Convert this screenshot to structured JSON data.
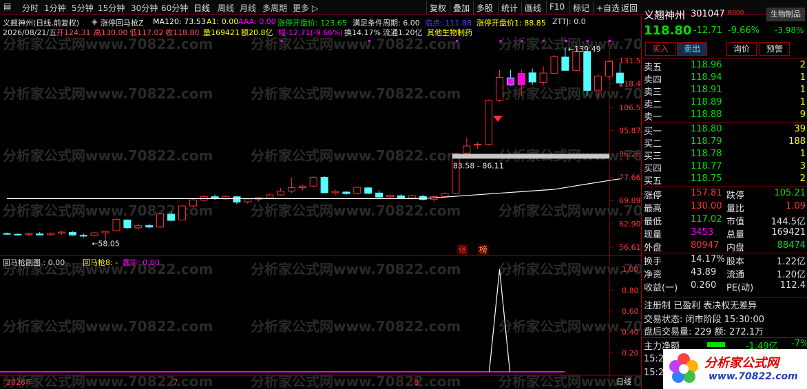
{
  "toolbar": {
    "left": [
      "分时",
      "1分钟",
      "5分钟",
      "15分钟",
      "30分钟",
      "60分钟",
      "日线",
      "周线",
      "月线",
      "多周期",
      "更多 ▷"
    ],
    "right": [
      "复权",
      "叠加",
      "多股",
      "统计",
      "画线",
      "F10",
      "标记",
      "+自选",
      "返回"
    ]
  },
  "header": {
    "title": "义翘神州(日线,前复权)",
    "indicator": "涨停回马枪Z",
    "ma120": "MA120: 73.53",
    "a1": "A1: 0.00",
    "aaa": "AAA: 0.00",
    "open_price_line": "涨停开盘价: 123.65",
    "cond": "满足条件周期: 6.00",
    "sell_point": "临点: 111.88",
    "zt_open": "涨停开盘价1: 88.85",
    "zttj": "ZTTJ: 0.0"
  },
  "header2": {
    "date": "2026/08/21/五",
    "open": "开124.31",
    "high": "高130.00",
    "low": "低117.02",
    "close": "收118.80",
    "vol": "量169421",
    "amount": "额20.8亿",
    "change": "幅-12.71(-9.66%)",
    "turnover": "换14.17%",
    "float": "流通1.20亿",
    "industry": "其他生物制药"
  },
  "chart": {
    "yticks": [
      "131.5",
      "118.4",
      "106.5",
      "95.87",
      "86.28",
      "77.66",
      "69.89",
      "62.90",
      "56.61"
    ],
    "max_label": "139.49",
    "min_label": "58.05",
    "zone_label": "83.58 - 86.11",
    "tags": [
      "张",
      "榜"
    ],
    "xlabels": [
      "2026年",
      "7",
      "8"
    ],
    "period": "日线"
  },
  "sub": {
    "title": "回马枪副图 : 0.00",
    "s1": "回马枪8: -",
    "s2": "蠢牛: 0.00",
    "yticks": [
      "1.00",
      "0.80",
      "0.60",
      "0.40",
      "0.20"
    ]
  },
  "watermark": "分析家公式网www.70822.com",
  "stock": {
    "name": "义翘神州",
    "code": "301047",
    "tag": "R000",
    "sector": "生物制品",
    "price": "118.80",
    "chg": "-12.71",
    "pct": "-9.66%",
    "sector_pct": "-3.98%"
  },
  "buttons": [
    "买入",
    "卖出",
    "询价",
    "预警"
  ],
  "asks": [
    [
      "卖五",
      "118.96",
      "2"
    ],
    [
      "卖四",
      "118.94",
      "1"
    ],
    [
      "卖三",
      "118.91",
      "1"
    ],
    [
      "卖二",
      "118.89",
      "1"
    ],
    [
      "卖一",
      "118.88",
      "9"
    ]
  ],
  "bids": [
    [
      "买一",
      "118.80",
      "39"
    ],
    [
      "买二",
      "118.79",
      "188"
    ],
    [
      "买三",
      "118.78",
      "1"
    ],
    [
      "买四",
      "118.77",
      "3"
    ],
    [
      "买五",
      "118.75",
      "2"
    ]
  ],
  "stats": [
    [
      "涨停",
      "157.81",
      "跌停",
      "105.21"
    ],
    [
      "最高",
      "130.00",
      "量比",
      "1.09"
    ],
    [
      "最低",
      "117.02",
      "市值",
      "144.5亿"
    ],
    [
      "现量",
      "3453",
      "总量",
      "169421"
    ],
    [
      "外盘",
      "80947",
      "内盘",
      "88474"
    ]
  ],
  "stats2": [
    [
      "换手",
      "14.17%",
      "股本",
      "1.22亿"
    ],
    [
      "净资",
      "43.89",
      "流通",
      "1.20亿"
    ],
    [
      "收益(一)",
      "0.260",
      "PE(动)",
      "112.4"
    ]
  ],
  "notes": {
    "reg": "注册制 已盈利 表决权无差异",
    "state": "交易状态: 闭市阶段 15:30:00",
    "after": "盘后交易量: 229  额: 272.1万",
    "flow_label": "主力净额",
    "flow_val": "-1.49亿",
    "flow_pct": "-7%",
    "time1": "15:2",
    "time2": "15:2"
  },
  "logo": {
    "text": "分析家公式网",
    "url": "www.70822.com"
  },
  "colors": {
    "up": "#ff3232",
    "down": "#54ffff",
    "bg": "#000000",
    "accent": "#ffff00",
    "magenta": "#ff00ff"
  },
  "chart_data": {
    "type": "candlestick",
    "candles": [
      [
        60.2,
        60.5,
        59.8,
        60.1
      ],
      [
        60.0,
        60.3,
        59.6,
        59.9
      ],
      [
        59.9,
        60.4,
        59.5,
        60.2
      ],
      [
        60.1,
        60.6,
        59.8,
        59.8
      ],
      [
        59.9,
        60.5,
        59.6,
        60.3
      ],
      [
        60.3,
        60.9,
        59.9,
        60.6
      ],
      [
        60.5,
        60.8,
        59.6,
        59.8
      ],
      [
        59.7,
        60.2,
        59.2,
        59.6
      ],
      [
        59.7,
        60.7,
        59.4,
        60.4
      ],
      [
        60.4,
        61.0,
        58.1,
        60.8
      ],
      [
        61.0,
        64.6,
        60.8,
        64.2
      ],
      [
        64.0,
        64.2,
        61.5,
        61.8
      ],
      [
        61.8,
        63.0,
        61.2,
        62.4
      ],
      [
        62.4,
        63.0,
        61.6,
        62.0
      ],
      [
        62.0,
        66.0,
        61.8,
        65.8
      ],
      [
        65.7,
        66.5,
        63.6,
        63.9
      ],
      [
        64.0,
        68.4,
        63.8,
        68.2
      ],
      [
        68.2,
        70.4,
        67.7,
        70.1
      ],
      [
        70.0,
        71.6,
        69.5,
        71.2
      ],
      [
        71.1,
        71.8,
        70.0,
        70.5
      ],
      [
        70.4,
        71.6,
        70.0,
        71.2
      ],
      [
        71.1,
        71.4,
        68.8,
        69.4
      ],
      [
        69.5,
        70.6,
        68.9,
        70.4
      ],
      [
        70.3,
        71.0,
        69.5,
        70.8
      ],
      [
        70.7,
        72.0,
        70.3,
        71.7
      ],
      [
        71.7,
        73.9,
        71.5,
        72.9
      ],
      [
        72.9,
        77.5,
        72.3,
        74.1
      ],
      [
        74.1,
        75.0,
        73.2,
        74.6
      ],
      [
        74.6,
        78.1,
        74.2,
        77.6
      ],
      [
        77.6,
        78.0,
        72.1,
        72.4
      ],
      [
        72.4,
        73.4,
        71.6,
        72.8
      ],
      [
        72.6,
        73.0,
        71.8,
        72.1
      ],
      [
        72.2,
        74.5,
        71.8,
        74.2
      ],
      [
        74.0,
        74.4,
        71.9,
        72.2
      ],
      [
        72.3,
        73.2,
        70.6,
        71.0
      ],
      [
        71.1,
        72.0,
        70.4,
        71.6
      ],
      [
        71.4,
        71.9,
        70.4,
        70.7
      ],
      [
        70.7,
        71.8,
        70.1,
        71.4
      ],
      [
        71.2,
        71.7,
        69.9,
        70.2
      ],
      [
        70.3,
        71.6,
        69.6,
        71.2
      ],
      [
        71.2,
        72.5,
        70.8,
        72.2
      ],
      [
        72.2,
        86.6,
        72.0,
        86.3
      ],
      [
        86.6,
        92.9,
        86.2,
        89.4
      ],
      [
        89.8,
        91.0,
        88.3,
        90.1
      ],
      [
        90.0,
        110.3,
        89.6,
        109.9
      ],
      [
        110.0,
        126.0,
        109.2,
        121.9
      ],
      [
        121.6,
        126.2,
        117.3,
        117.8
      ],
      [
        117.8,
        126.4,
        112.2,
        124.1
      ],
      [
        124.4,
        126.8,
        117.9,
        119.4
      ],
      [
        119.2,
        128.2,
        117.6,
        124.3
      ],
      [
        124.1,
        134.7,
        123.8,
        133.8
      ],
      [
        133.6,
        139.5,
        126.2,
        125.8
      ],
      [
        125.8,
        139.0,
        125.1,
        137.1
      ],
      [
        137.0,
        137.5,
        112.0,
        114.9
      ],
      [
        115.0,
        124.0,
        110.0,
        122.6
      ],
      [
        122.5,
        132.0,
        120.6,
        131.0
      ],
      [
        124.3,
        130.0,
        117.0,
        118.8
      ]
    ]
  }
}
